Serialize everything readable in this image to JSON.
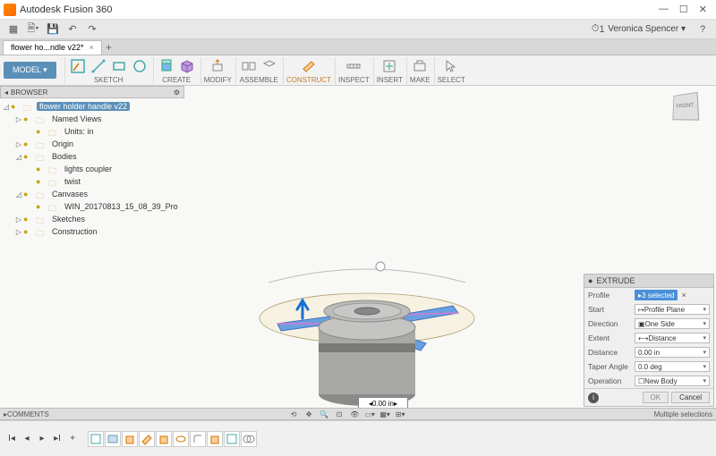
{
  "app": {
    "title": "Autodesk Fusion 360"
  },
  "quickbar": {
    "user": "Veronica Spencer",
    "notif_count": "1"
  },
  "tab": {
    "name": "flower ho...ndle v22*"
  },
  "toolbar": {
    "model_label": "MODEL",
    "groups": [
      "SKETCH",
      "CREATE",
      "MODIFY",
      "ASSEMBLE",
      "CONSTRUCT",
      "INSPECT",
      "INSERT",
      "MAKE",
      "SELECT"
    ]
  },
  "browser": {
    "title": "BROWSER",
    "root": "flower holder handle v22",
    "items": [
      {
        "label": "Named Views",
        "indent": 1,
        "arrow": "▷"
      },
      {
        "label": "Units: in",
        "indent": 2,
        "arrow": ""
      },
      {
        "label": "Origin",
        "indent": 1,
        "arrow": "▷"
      },
      {
        "label": "Bodies",
        "indent": 1,
        "arrow": "◿"
      },
      {
        "label": "lights coupler",
        "indent": 2,
        "arrow": ""
      },
      {
        "label": "twist",
        "indent": 2,
        "arrow": ""
      },
      {
        "label": "Canvases",
        "indent": 1,
        "arrow": "◿"
      },
      {
        "label": "WIN_20170813_15_08_39_Pro",
        "indent": 2,
        "arrow": ""
      },
      {
        "label": "Sketches",
        "indent": 1,
        "arrow": "▷"
      },
      {
        "label": "Construction",
        "indent": 1,
        "arrow": "▷"
      }
    ]
  },
  "viewcube": {
    "face": "FRONT"
  },
  "dim_value": "0.00 in",
  "extrude": {
    "title": "EXTRUDE",
    "profile_label": "Profile",
    "profile_value": "3 selected",
    "start_label": "Start",
    "start_value": "Profile Plane",
    "direction_label": "Direction",
    "direction_value": "One Side",
    "extent_label": "Extent",
    "extent_value": "Distance",
    "distance_label": "Distance",
    "distance_value": "0.00 in",
    "taper_label": "Taper Angle",
    "taper_value": "0.0 deg",
    "operation_label": "Operation",
    "operation_value": "New Body",
    "ok": "OK",
    "cancel": "Cancel"
  },
  "comments": {
    "label": "COMMENTS",
    "status": "Multiple selections"
  }
}
